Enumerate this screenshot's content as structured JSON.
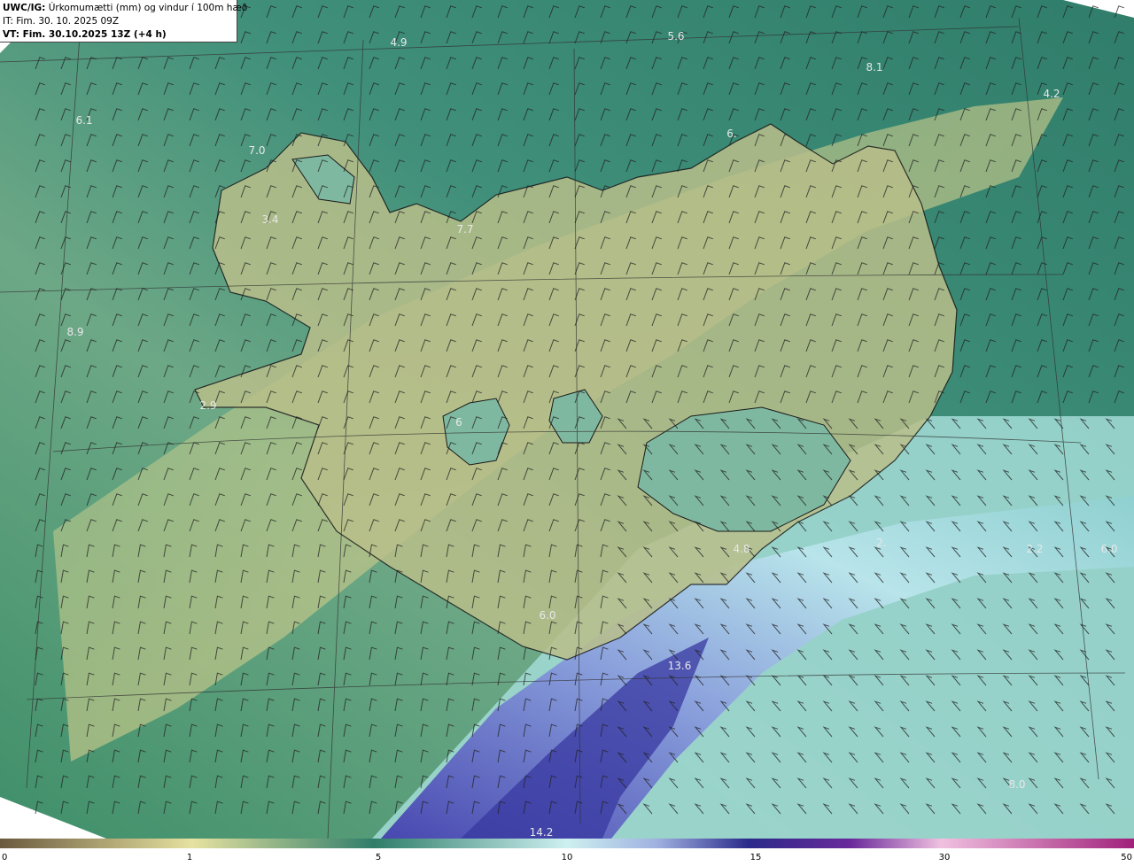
{
  "header": {
    "model": "UWC/IG:",
    "title": "Úrkomumætti (mm) og vindur í 100m hæð",
    "it_line": "IT: Fim. 30. 10. 2025 09Z",
    "vt_label": "VT: Fim. 30.10.2025 13Z",
    "vt_offset": "(+4 h)"
  },
  "map_values": [
    "4.9",
    "5.6",
    "8.1",
    "4.2",
    "6.1",
    "7.0",
    "3.4",
    "7.7",
    "6.",
    "8.9",
    "2.9",
    "6",
    "4.8",
    "2.",
    "2.2",
    "6.0",
    "6.0",
    "13.6",
    "14.2",
    "8.0"
  ],
  "colorbar": {
    "ticks": [
      "0",
      "1",
      "5",
      "10",
      "15",
      "30",
      "50"
    ],
    "colors": [
      "#6b5a3e",
      "#c9b98a",
      "#e6e2a0",
      "#7fb38f",
      "#2f7d6a",
      "#bfeaea",
      "#9fb0e0",
      "#2a2a8a",
      "#6a2a9a",
      "#d070c0",
      "#a0207a"
    ]
  },
  "colors": {
    "land_low": "#c9c98a",
    "sea": "#3f8f7a",
    "heavy_precip": "#3a3aa0"
  }
}
